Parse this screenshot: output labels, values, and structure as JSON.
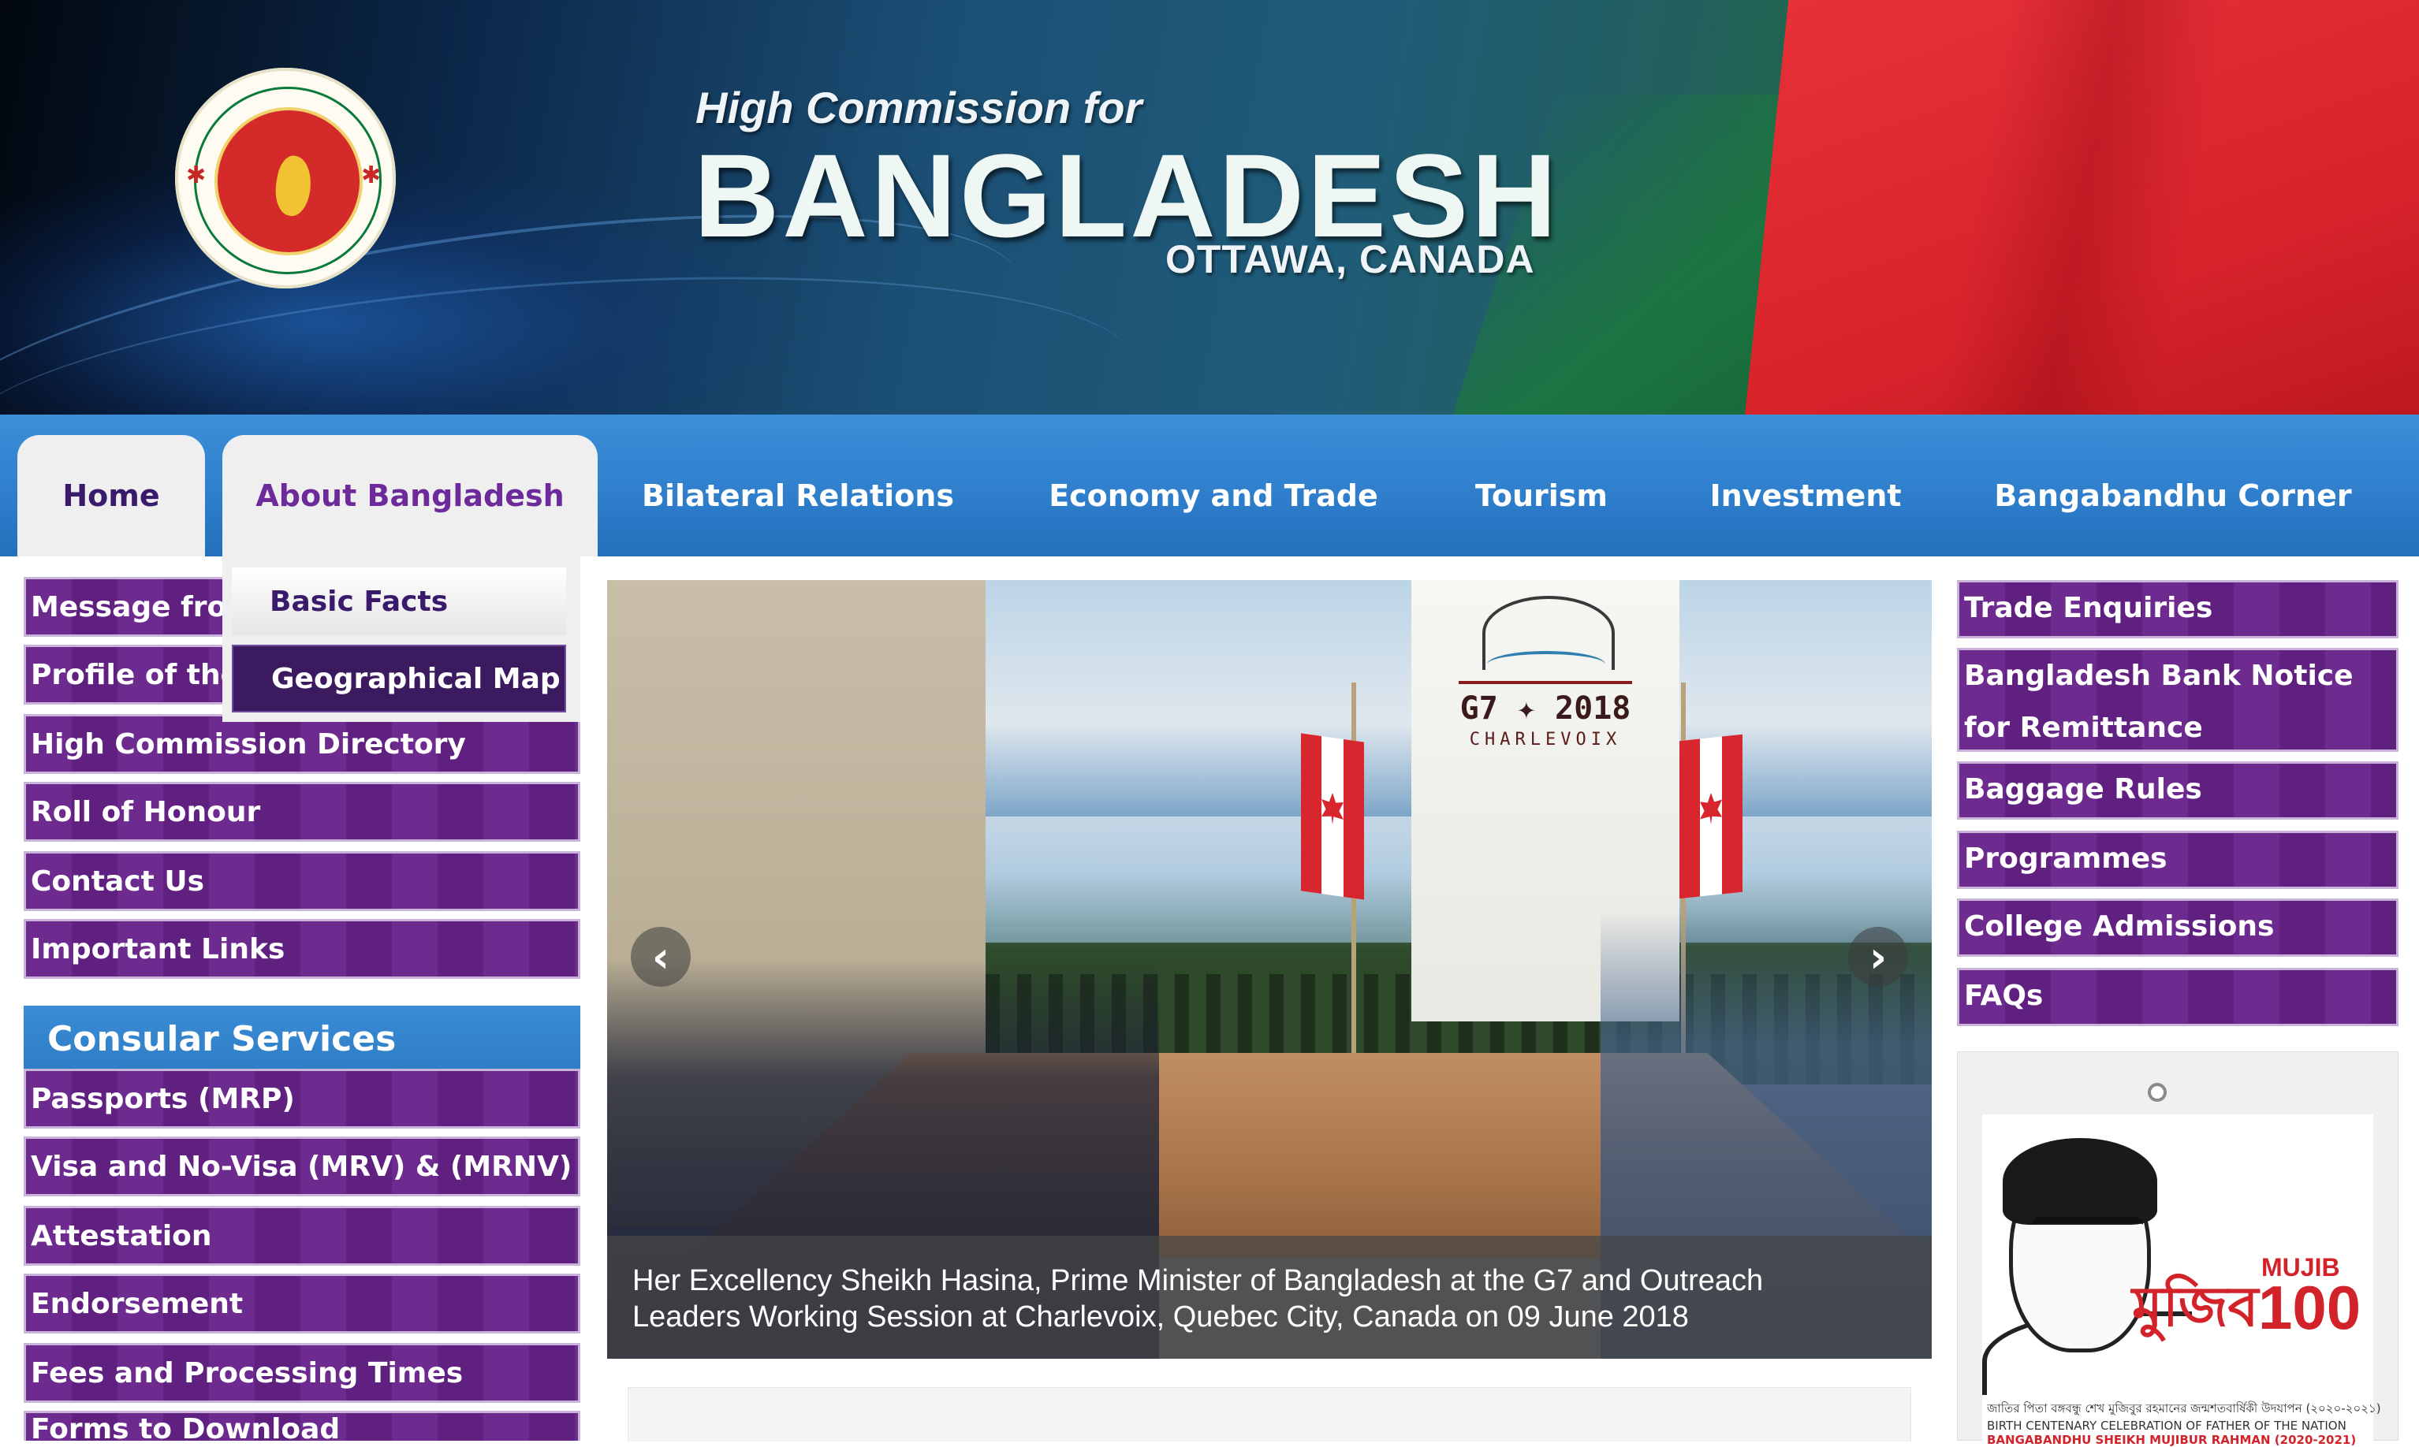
{
  "header": {
    "title_small": "High Commission for",
    "title_main": "BANGLADESH",
    "title_sub": "OTTAWA, CANADA"
  },
  "nav": {
    "tabs": [
      {
        "label": "Home"
      },
      {
        "label": "About Bangladesh"
      },
      {
        "label": "Bilateral Relations"
      },
      {
        "label": "Economy and Trade"
      },
      {
        "label": "Tourism"
      },
      {
        "label": "Investment"
      },
      {
        "label": "Bangabandhu Corner"
      }
    ]
  },
  "dropdown": {
    "items": [
      {
        "label": "Basic Facts"
      },
      {
        "label": "Geographical Map"
      }
    ]
  },
  "left_menu": {
    "items": [
      {
        "label": "Message from the High Commissioner"
      },
      {
        "label": "Profile of the High Commissioner"
      },
      {
        "label": "High Commission Directory"
      },
      {
        "label": "Roll of Honour"
      },
      {
        "label": "Contact Us"
      },
      {
        "label": "Important Links"
      }
    ],
    "consular_heading": "Consular Services",
    "consular_items": [
      {
        "label": "Passports (MRP)"
      },
      {
        "label": "Visa and No-Visa (MRV) & (MRNV)"
      },
      {
        "label": "Attestation"
      },
      {
        "label": "Endorsement"
      },
      {
        "label": "Fees and Processing Times"
      },
      {
        "label": "Forms to Download"
      }
    ]
  },
  "slider": {
    "g7_year": "G7 ✦ 2018",
    "g7_city": "CHARLEVOIX",
    "prev_glyph": "‹",
    "next_glyph": "›",
    "caption_line1": "Her Excellency Sheikh Hasina, Prime Minister of Bangladesh at the G7 and Outreach",
    "caption_line2": "Leaders Working Session at Charlevoix, Quebec City, Canada on 09 June 2018"
  },
  "right_menu": {
    "items": [
      {
        "label": "Trade Enquiries"
      },
      {
        "label": "Bangladesh Bank Notice for Remittance"
      },
      {
        "label": "Baggage Rules"
      },
      {
        "label": "Programmes"
      },
      {
        "label": "College Admissions"
      },
      {
        "label": "FAQs"
      }
    ]
  },
  "mujib_card": {
    "bengali_title": "মুজিব",
    "english_title": "MUJIB",
    "number": "100",
    "line_bengali": "জাতির পিতা বঙ্গবন্ধু শেখ মুজিবুর রহমানের জন্মশতবার্ষিকী উদযাপন (২০২০-২০২১)",
    "line_english": "BIRTH CENTENARY CELEBRATION OF FATHER OF THE NATION",
    "line_name": "BANGABANDHU SHEIKH MUJIBUR RAHMAN (2020-2021)"
  },
  "colors": {
    "nav_blue": "#2f7fcd",
    "menu_purple": "#6d2a8f",
    "dropdown_active": "#3b1a60",
    "flag_red": "#e0242b",
    "flag_green": "#1f6a43"
  },
  "icons": {
    "prev": "chevron-left-icon",
    "next": "chevron-right-icon",
    "seal": "government-seal-icon"
  }
}
